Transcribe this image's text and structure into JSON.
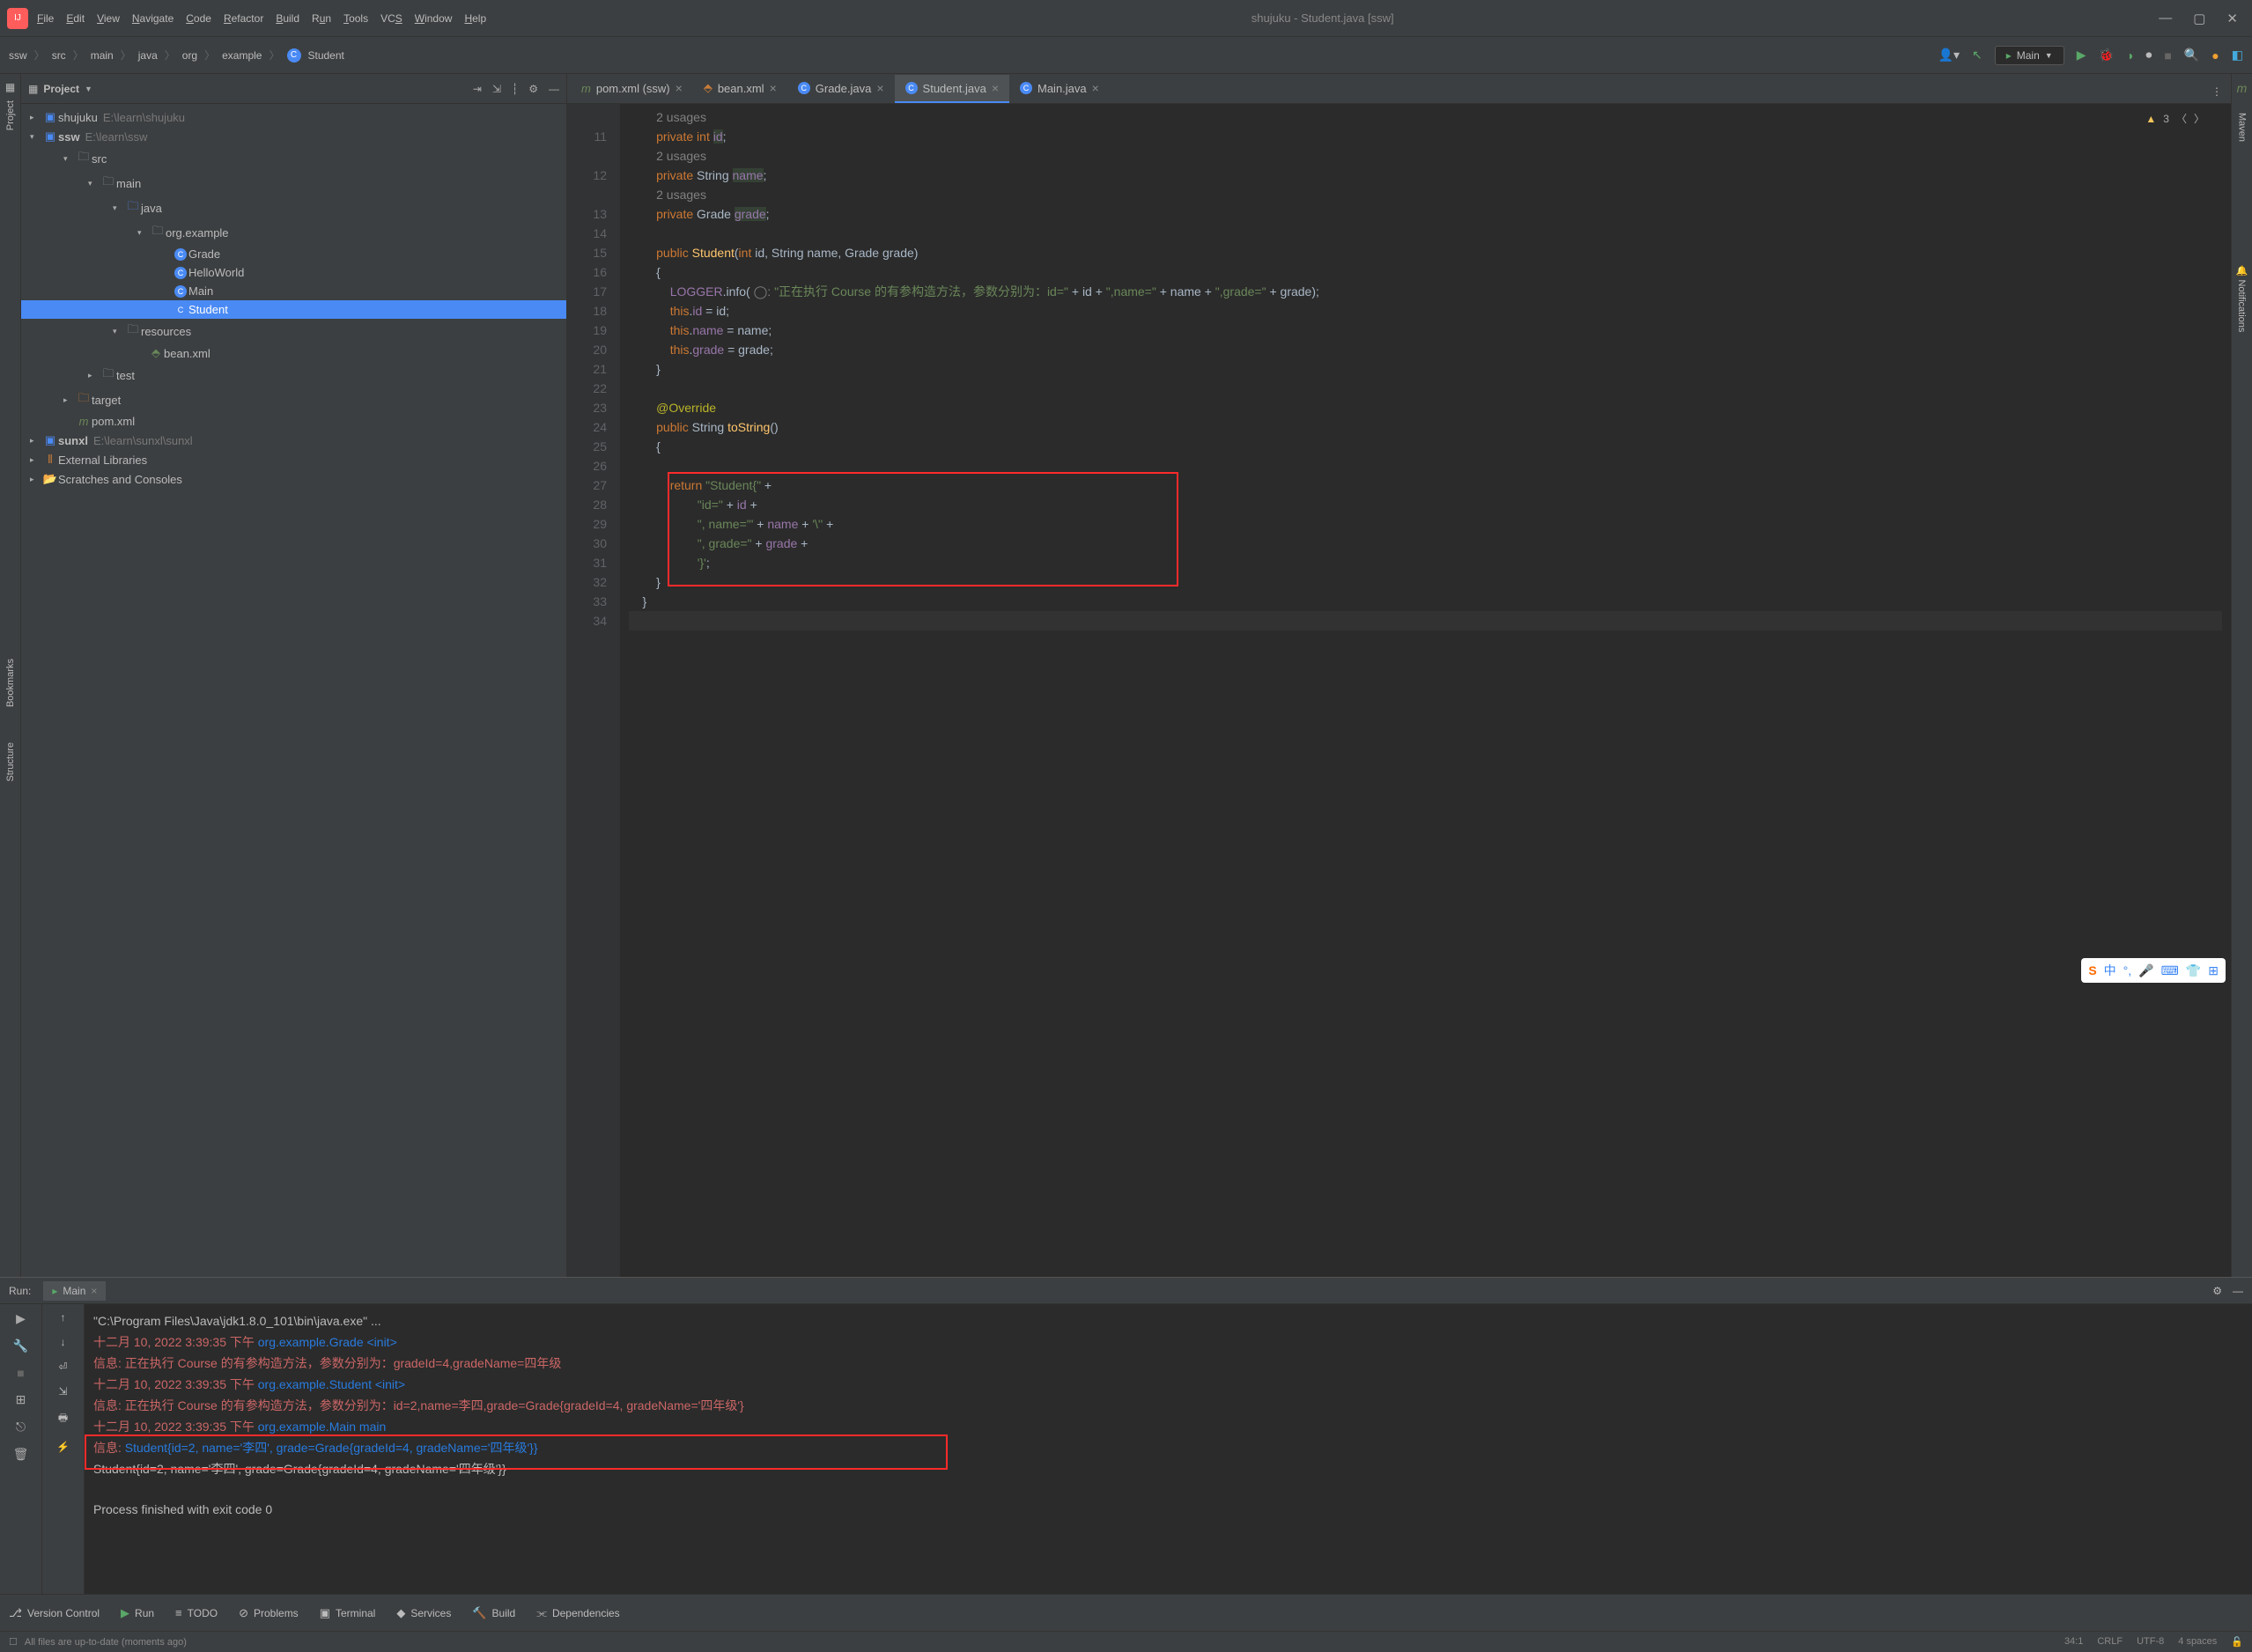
{
  "window": {
    "title": "shujuku - Student.java [ssw]"
  },
  "menu": [
    "File",
    "Edit",
    "View",
    "Navigate",
    "Code",
    "Refactor",
    "Build",
    "Run",
    "Tools",
    "VCS",
    "Window",
    "Help"
  ],
  "breadcrumb": [
    "ssw",
    "src",
    "main",
    "java",
    "org",
    "example"
  ],
  "breadcrumb_last": "Student",
  "runconfig": "Main",
  "panel": {
    "title": "Project"
  },
  "tree": {
    "shujuku": "shujuku",
    "shujuku_path": "E:\\learn\\shujuku",
    "ssw": "ssw",
    "ssw_path": "E:\\learn\\ssw",
    "src": "src",
    "main": "main",
    "java": "java",
    "pkg": "org.example",
    "Grade": "Grade",
    "HelloWorld": "HelloWorld",
    "Main": "Main",
    "Student": "Student",
    "resources": "resources",
    "beanxml": "bean.xml",
    "test": "test",
    "target": "target",
    "pomxml": "pom.xml",
    "sunxl": "sunxl",
    "sunxl_path": "E:\\learn\\sunxl\\sunxl",
    "extlib": "External Libraries",
    "scratch": "Scratches and Consoles"
  },
  "tabs": [
    {
      "name": "pom.xml (ssw)",
      "type": "m"
    },
    {
      "name": "bean.xml",
      "type": "xml"
    },
    {
      "name": "Grade.java",
      "type": "class"
    },
    {
      "name": "Student.java",
      "type": "class",
      "active": true
    },
    {
      "name": "Main.java",
      "type": "class"
    }
  ],
  "warn": "3",
  "lines": {
    "start": 11,
    "end": 34,
    "usages": "2 usages",
    "l11": "private int id;",
    "l12": "private String name;",
    "l13": "private Grade grade;",
    "log_str": "\"正在执行 Course 的有参构造方法，参数分别为：id=\"",
    "ret_a": "\"Student{\"",
    "ret_b": "\"id=\"",
    "ret_c": "\", name='\"",
    "ret_d": "\", grade=\"",
    "ret_e": "'}'"
  },
  "run": {
    "label": "Run:",
    "tab": "Main",
    "line1": "\"C:\\Program Files\\Java\\jdk1.8.0_101\\bin\\java.exe\" ...",
    "line2a": "十二月 10, 2022 3:39:35 下午 ",
    "line2b": "org.example.Grade <init>",
    "line3": "信息: 正在执行 Course 的有参构造方法，参数分别为：gradeId=4,gradeName=四年级",
    "line4a": "十二月 10, 2022 3:39:35 下午 ",
    "line4b": "org.example.Student <init>",
    "line5": "信息: 正在执行 Course 的有参构造方法，参数分别为：id=2,name=李四,grade=Grade{gradeId=4, gradeName='四年级'}",
    "line6a": "十二月 10, 2022 3:39:35 下午 ",
    "line6b": "org.example.Main main",
    "line7a": "信息: ",
    "line7b": "Student{id=2, name='李四', grade=Grade{gradeId=4, gradeName='四年级'}}",
    "line8": "Student{id=2, name='李四', grade=Grade{gradeId=4, gradeName='四年级'}}",
    "line9": "Process finished with exit code 0"
  },
  "btabs": {
    "version": "Version Control",
    "run": "Run",
    "todo": "TODO",
    "problems": "Problems",
    "terminal": "Terminal",
    "services": "Services",
    "build": "Build",
    "deps": "Dependencies"
  },
  "status": {
    "left": "All files are up-to-date (moments ago)",
    "pos": "34:1",
    "crlf": "CRLF",
    "enc": "UTF-8",
    "indent": "4 spaces"
  }
}
